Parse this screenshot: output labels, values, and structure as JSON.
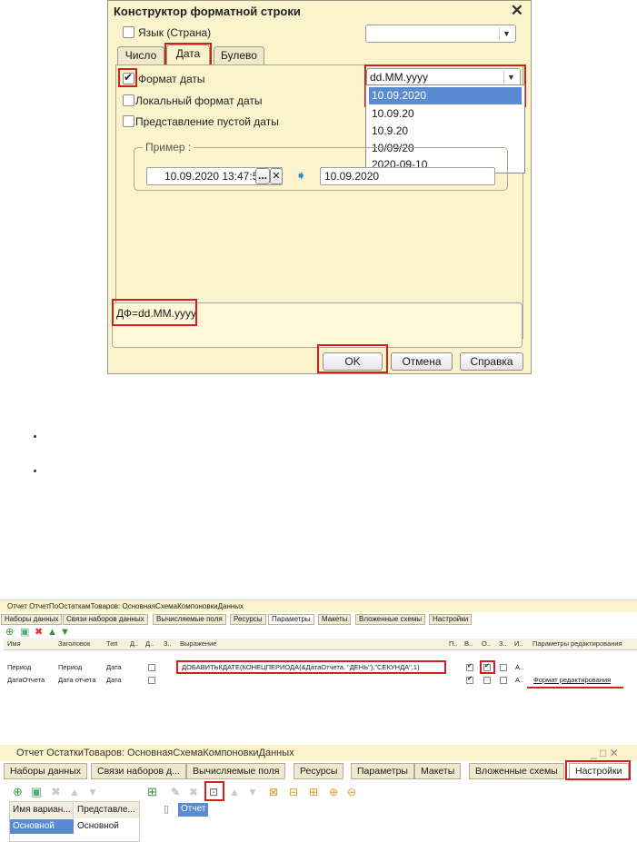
{
  "dialog": {
    "title": "Конструктор форматной строки",
    "close_label": "✕",
    "language_label": "Язык (Страна)",
    "tabs": [
      "Число",
      "Дата",
      "Булево"
    ],
    "date_format_label": "Формат даты",
    "local_format_label": "Локальный формат даты",
    "empty_date_label": "Представление пустой даты",
    "date_format_value": "dd.MM.yyyy",
    "dropdown_options": [
      "10.09.2020",
      "10.09.20",
      "10.9.20",
      "10/09/20",
      "2020-09-10"
    ],
    "example_legend": "Пример :",
    "example_input": "10.09.2020 13:47:54",
    "example_output": "10.09.2020",
    "format_string": "ДФ=dd.MM.yyyy",
    "buttons": {
      "ok": "OK",
      "cancel": "Отмена",
      "help": "Справка"
    }
  },
  "screen2": {
    "title": "Отчет ОтчетПоОстаткамТоваров: ОсновнаяСхемаКомпоновкиДанных",
    "tabs": [
      "Наборы данных",
      "Связи наборов данных",
      "Вычисляемые поля",
      "Ресурсы",
      "Параметры",
      "Макеты",
      "Вложенные схемы",
      "Настройки"
    ],
    "headers": [
      "Имя",
      "Заголовок",
      "Тип",
      "Д..",
      "Д..",
      "З..",
      "Выражение",
      "П..",
      "В..",
      "О..",
      "З..",
      "И..",
      "Параметры редактирования"
    ],
    "rows": [
      {
        "name": "Период",
        "caption": "Период",
        "type": "Дата",
        "expr": "ДОБАВИТЬКДАТЕ(КОНЕЦПЕРИОДА(&ДатаОтчета, \"ДЕНЬ\"),\"СЕКУНДА\",1)",
        "i": "А..",
        "edit": ""
      },
      {
        "name": "ДатаОтчета",
        "caption": "Дата отчета",
        "type": "Дата",
        "expr": "",
        "i": "А..",
        "edit": "Формат редактирования"
      }
    ]
  },
  "screen3": {
    "title": "Отчет ОстаткиТоваров: ОсновнаяСхемаКомпоновкиДанных",
    "window_controls": "_ □ ✕",
    "tabs": [
      "Наборы данных",
      "Связи наборов д...",
      "Вычисляемые поля",
      "Ресурсы",
      "Параметры",
      "Макеты",
      "Вложенные схемы",
      "Настройки"
    ],
    "variant_headers": [
      "Имя вариан...",
      "Представле..."
    ],
    "variant_row": [
      "Основной",
      "Основной"
    ],
    "tree_root": "Отчет"
  },
  "colors": {
    "dialog_bg": "#fbf3cc",
    "highlight_red": "#d51e1e",
    "selection_blue": "#5a8bd0"
  }
}
